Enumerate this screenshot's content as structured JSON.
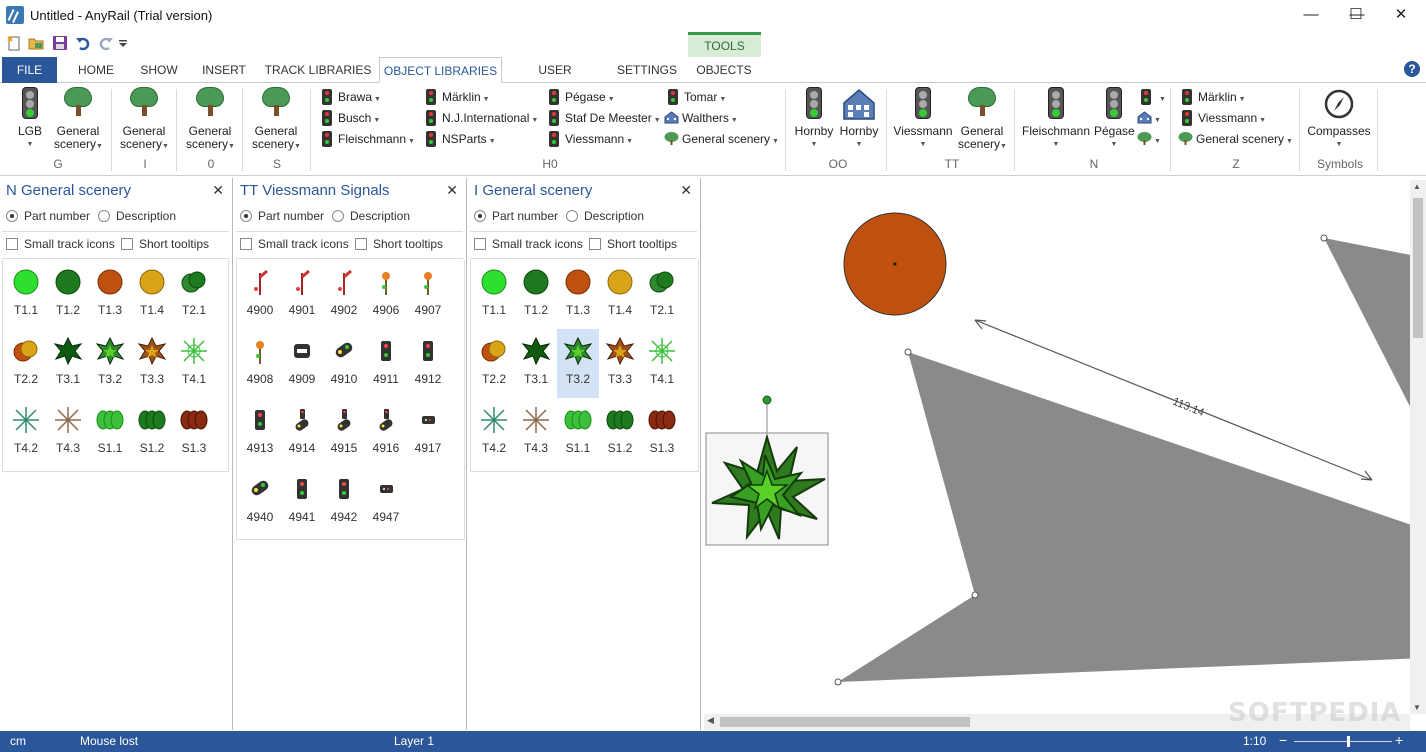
{
  "window": {
    "title": "Untitled - AnyRail (Trial version)",
    "minimize": "—",
    "maximize": "☐",
    "close": "✕"
  },
  "contextual_tab": "TOOLS",
  "tabs": [
    "FILE",
    "HOME",
    "SHOW",
    "INSERT",
    "TRACK LIBRARIES",
    "OBJECT LIBRARIES",
    "USER OBJECTS",
    "SETTINGS",
    "OBJECTS"
  ],
  "active_tab": "OBJECT LIBRARIES",
  "ribbon": {
    "g": {
      "lgb": "LGB",
      "general": [
        "General",
        "scenery"
      ],
      "group": "G"
    },
    "i": {
      "general": [
        "General",
        "scenery"
      ],
      "group": "I"
    },
    "zero": {
      "general": [
        "General",
        "scenery"
      ],
      "group": "0"
    },
    "s": {
      "general": [
        "General",
        "scenery"
      ],
      "group": "S"
    },
    "h0": {
      "col1": [
        "Brawa",
        "Busch",
        "Fleischmann"
      ],
      "col2": [
        "Märklin",
        "N.J.International",
        "NSParts"
      ],
      "col3": [
        "Pégase",
        "Staf De Meester",
        "Viessmann"
      ],
      "col4": [
        "Tomar",
        "Walthers",
        "General scenery"
      ],
      "group": "H0"
    },
    "oo": {
      "a": "Hornby",
      "b": "Hornby",
      "group": "OO"
    },
    "tt": {
      "a": "Viessmann",
      "general": [
        "General",
        "scenery"
      ],
      "group": "TT"
    },
    "n": {
      "a": "Fleischmann",
      "b": "Pégase",
      "group": "N"
    },
    "z": {
      "items": [
        "Märklin",
        "Viessmann",
        "General scenery"
      ],
      "group": "Z"
    },
    "symbols": {
      "compasses": "Compasses",
      "group": "Symbols"
    }
  },
  "panels": [
    {
      "title": "N General scenery",
      "part_number": "Part number",
      "description": "Description",
      "small_icons": "Small track icons",
      "short_tooltips": "Short tooltips",
      "items": [
        "T1.1",
        "T1.2",
        "T1.3",
        "T1.4",
        "T2.1",
        "T2.2",
        "T3.1",
        "T3.2",
        "T3.3",
        "T4.1",
        "T4.2",
        "T4.3",
        "S1.1",
        "S1.2",
        "S1.3"
      ]
    },
    {
      "title": "TT Viessmann Signals",
      "part_number": "Part number",
      "description": "Description",
      "small_icons": "Small track icons",
      "short_tooltips": "Short tooltips",
      "items": [
        "4900",
        "4901",
        "4902",
        "4906",
        "4907",
        "4908",
        "4909",
        "4910",
        "4911",
        "4912",
        "4913",
        "4914",
        "4915",
        "4916",
        "4917",
        "4940",
        "4941",
        "4942",
        "4947"
      ]
    },
    {
      "title": "I General scenery",
      "part_number": "Part number",
      "description": "Description",
      "small_icons": "Small track icons",
      "short_tooltips": "Short tooltips",
      "items": [
        "T1.1",
        "T1.2",
        "T1.3",
        "T1.4",
        "T2.1",
        "T2.2",
        "T3.1",
        "T3.2",
        "T3.3",
        "T4.1",
        "T4.2",
        "T4.3",
        "S1.1",
        "S1.2",
        "S1.3"
      ],
      "selected": "T3.2"
    }
  ],
  "canvas": {
    "dimension": "113.14"
  },
  "status": {
    "unit": "cm",
    "mouse": "Mouse lost",
    "layer": "Layer 1",
    "scale": "1:10",
    "zoom_minus": "−",
    "zoom_plus": "+"
  },
  "watermark": "SOFTPEDIA",
  "colors": {
    "accent": "#2b579a",
    "tools_green": "#3a9a46",
    "selection": "#d4e2f5"
  }
}
